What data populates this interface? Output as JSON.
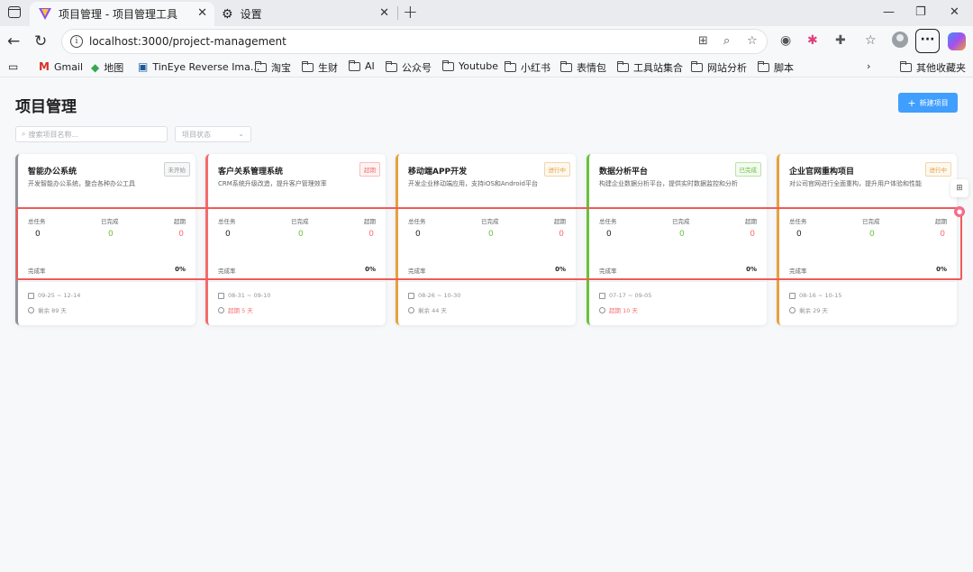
{
  "browser": {
    "tabs": [
      {
        "title": "项目管理 - 项目管理工具",
        "active": true
      },
      {
        "title": "设置",
        "active": false
      }
    ],
    "url": "localhost:3000/project-management",
    "bookmarks": [
      "Gmail",
      "地图",
      "TinEye Reverse Ima...",
      "淘宝",
      "生财",
      "AI",
      "公众号",
      "Youtube",
      "小红书",
      "表情包",
      "工具站集合",
      "网站分析",
      "脚本"
    ],
    "other_bookmarks": "其他收藏夹"
  },
  "page": {
    "title": "项目管理",
    "new_button": "新建项目",
    "search_placeholder": "搜索项目名称...",
    "status_placeholder": "项目状态"
  },
  "labels": {
    "total": "总任务",
    "done": "已完成",
    "overdue": "超期",
    "rate": "完成率"
  },
  "colors": {
    "primary": "#409eff",
    "success": "#67c23a",
    "danger": "#f56c6c",
    "warning": "#e6a23c",
    "info": "#909399",
    "highlight": "#f05a5a"
  },
  "projects": [
    {
      "name": "智能办公系统",
      "status": "未开始",
      "status_color": "#909399",
      "desc": "开发智能办公系统，整合各种办公工具",
      "total": "0",
      "done": "0",
      "overdue": "0",
      "rate": "0%",
      "date": "09-25 ~ 12-14",
      "remain": "剩余 89 天",
      "remain_color": "#909399"
    },
    {
      "name": "客户关系管理系统",
      "status": "超期",
      "status_color": "#f56c6c",
      "desc": "CRM系统升级改造，提升客户管理效率",
      "total": "0",
      "done": "0",
      "overdue": "0",
      "rate": "0%",
      "date": "08-31 ~ 09-10",
      "remain": "超期 5 天",
      "remain_color": "#f56c6c"
    },
    {
      "name": "移动端APP开发",
      "status": "进行中",
      "status_color": "#e6a23c",
      "desc": "开发企业移动端应用，支持iOS和Android平台",
      "total": "0",
      "done": "0",
      "overdue": "0",
      "rate": "0%",
      "date": "08-26 ~ 10-30",
      "remain": "剩余 44 天",
      "remain_color": "#909399"
    },
    {
      "name": "数据分析平台",
      "status": "已完成",
      "status_color": "#67c23a",
      "desc": "构建企业数据分析平台，提供实时数据监控和分析",
      "total": "0",
      "done": "0",
      "overdue": "0",
      "rate": "0%",
      "date": "07-17 ~ 09-05",
      "remain": "超期 10 天",
      "remain_color": "#f56c6c"
    },
    {
      "name": "企业官网重构项目",
      "status": "进行中",
      "status_color": "#e6a23c",
      "desc": "对公司官网进行全面重构，提升用户体验和性能",
      "total": "0",
      "done": "0",
      "overdue": "0",
      "rate": "0%",
      "date": "08-16 ~ 10-15",
      "remain": "剩余 29 天",
      "remain_color": "#909399"
    }
  ]
}
